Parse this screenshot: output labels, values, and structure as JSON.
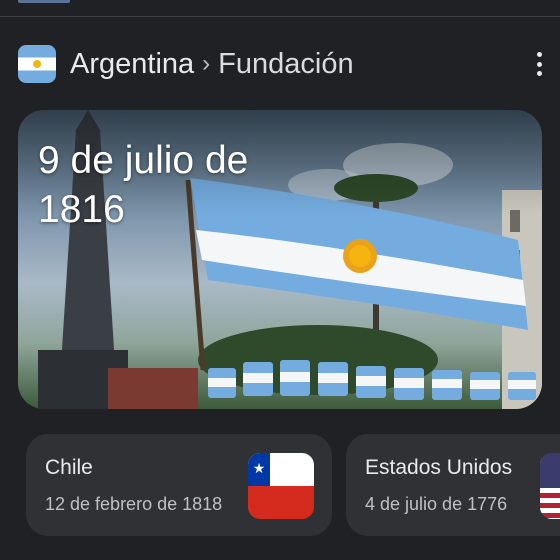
{
  "breadcrumb": {
    "country": "Argentina",
    "separator": "›",
    "topic": "Fundación"
  },
  "hero": {
    "title": "9 de julio de 1816"
  },
  "cards": [
    {
      "title": "Chile",
      "date": "12 de febrero de 1818",
      "flag_icon": "chile-flag-icon"
    },
    {
      "title": "Estados Unidos",
      "date": "4 de julio de 1776",
      "flag_icon": "usa-flag-icon"
    }
  ],
  "colors": {
    "background": "#202124",
    "card": "#303134",
    "argentina_blue": "#74acdf",
    "sun": "#f6b40e"
  }
}
